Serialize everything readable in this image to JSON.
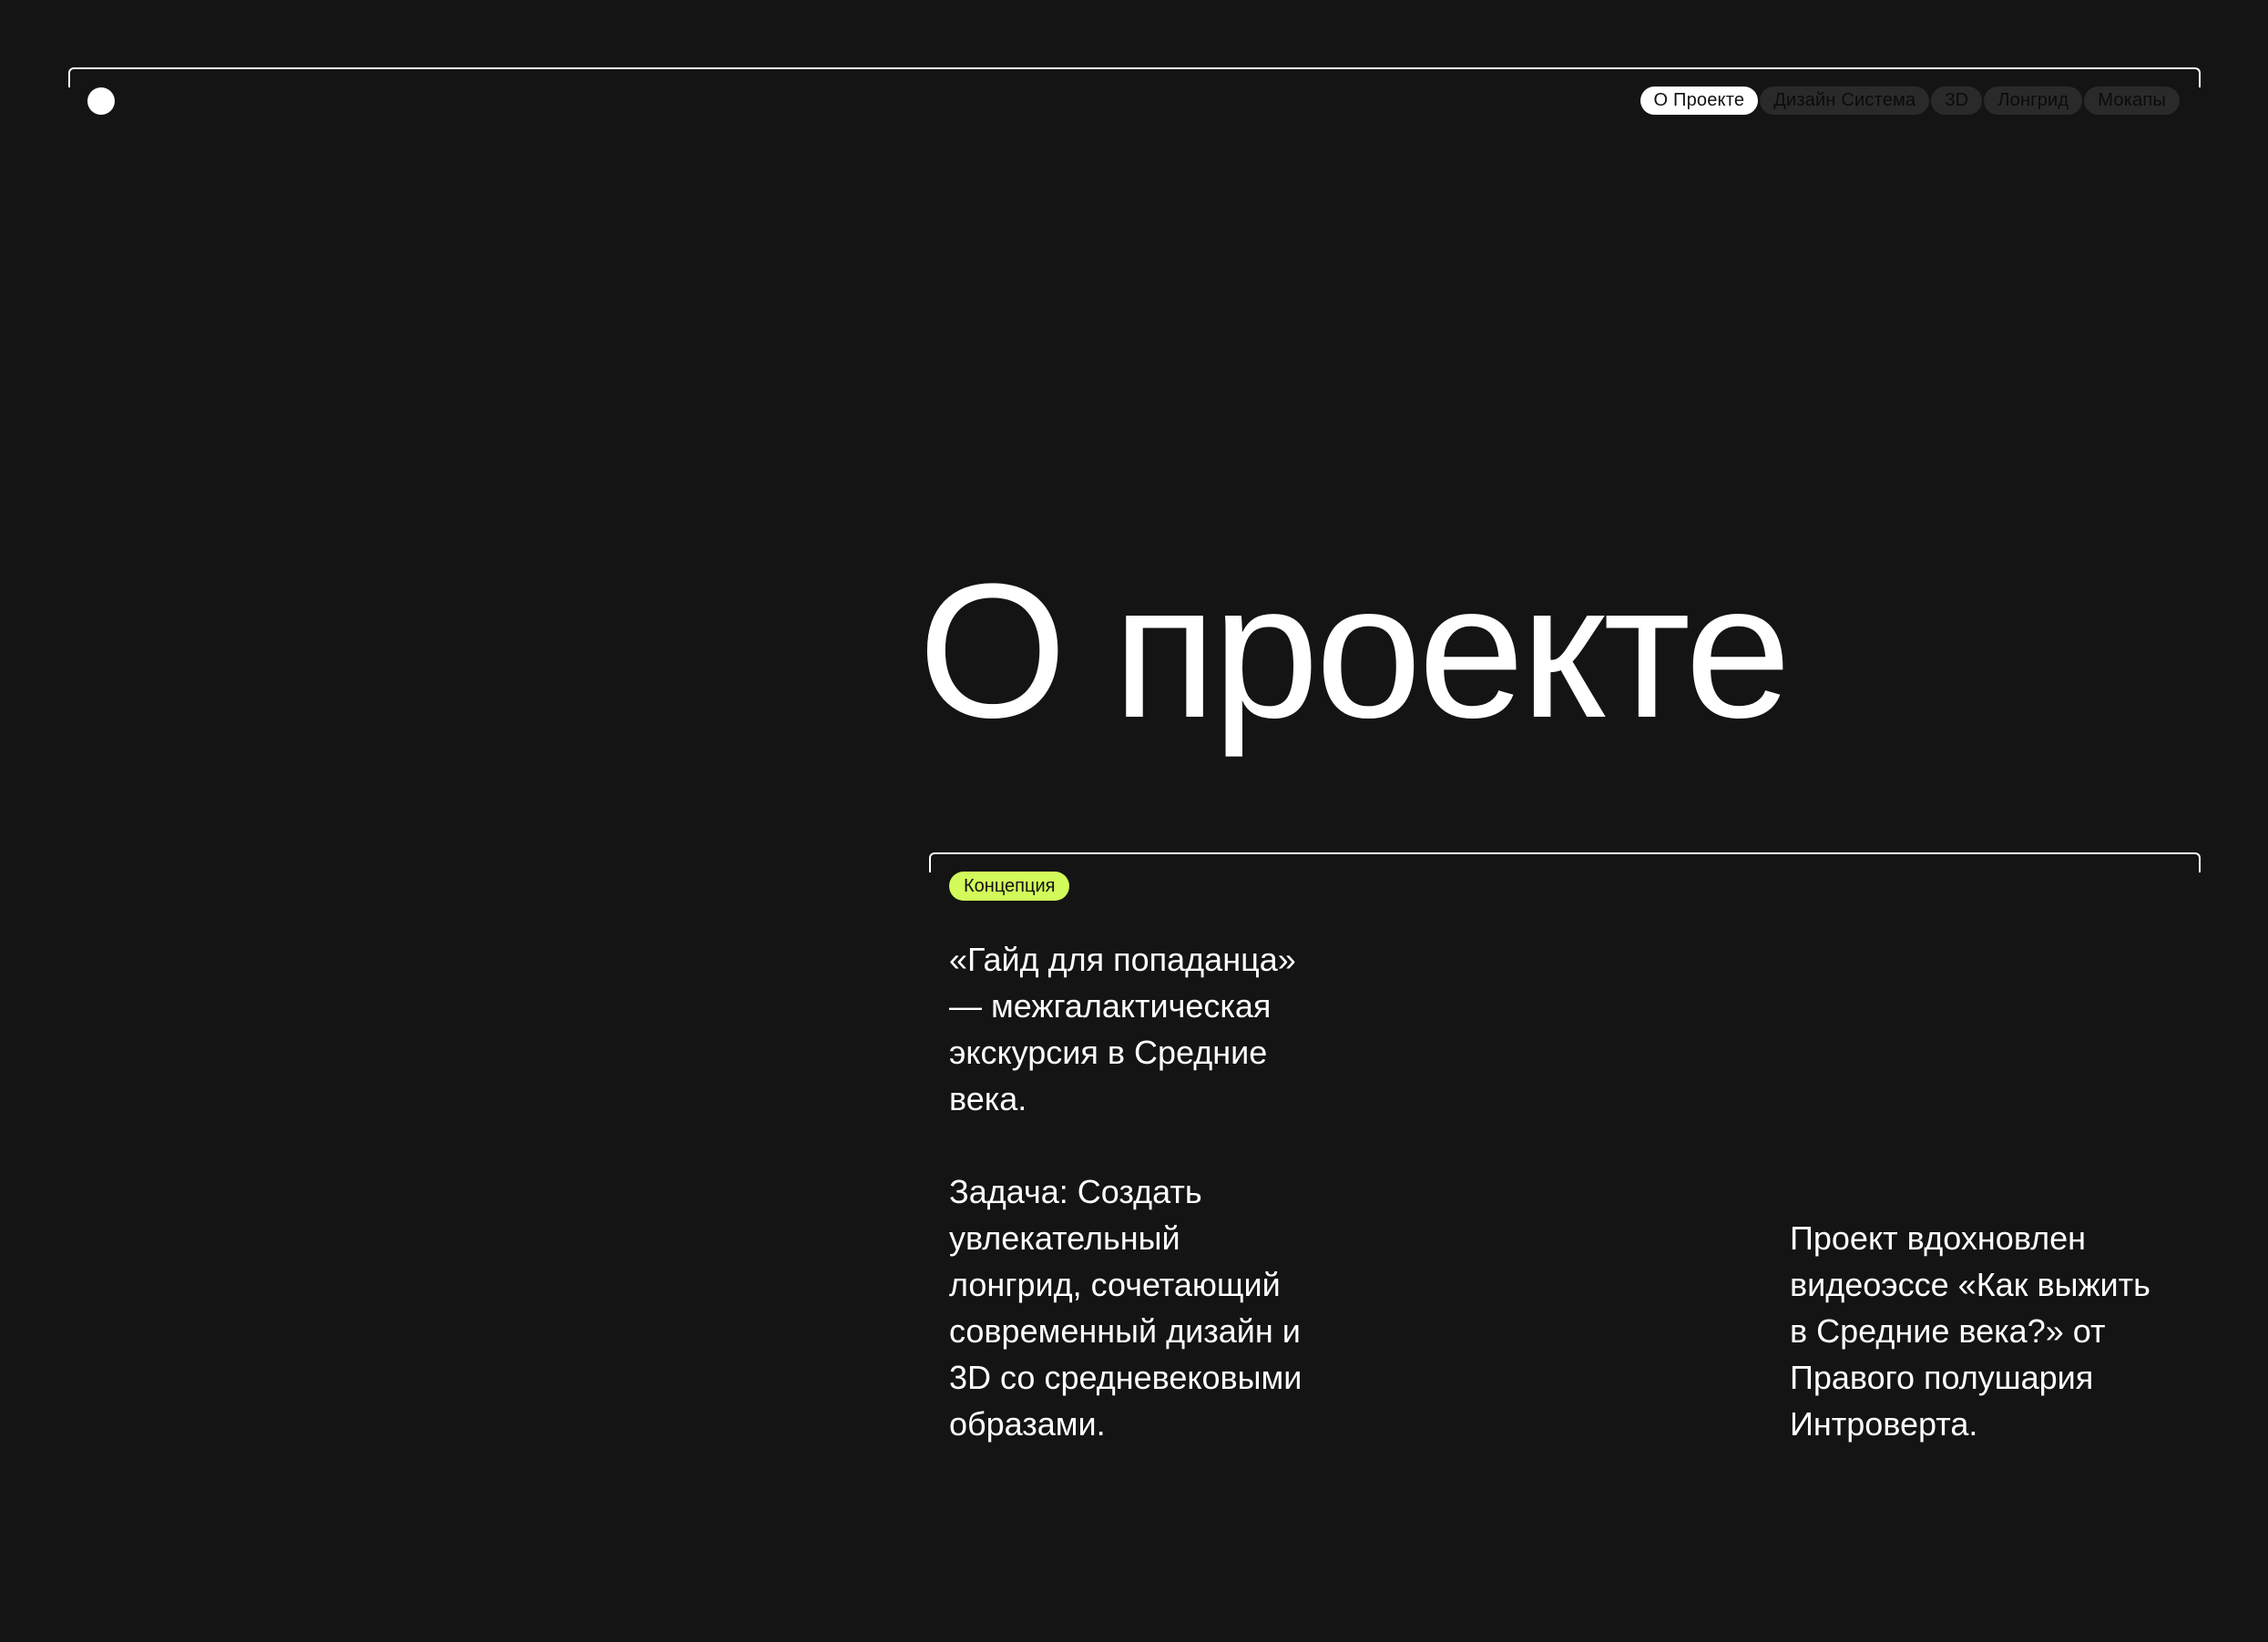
{
  "nav": {
    "items": [
      {
        "label": "О Проекте",
        "active": true
      },
      {
        "label": "Дизайн Система",
        "active": false
      },
      {
        "label": "3D",
        "active": false
      },
      {
        "label": "Лонгрид",
        "active": false
      },
      {
        "label": "Мокапы",
        "active": false
      }
    ]
  },
  "hero": {
    "title": "О проекте"
  },
  "section": {
    "tag": "Концепция",
    "left_text": "«Гайд для попаданца»\n— межгалактическая\nэкскурсия в Средние\nвека.\n\nЗадача: Создать\nувлекательный\nлонгрид, сочетающий\nсовременный дизайн и\n3D со средневековыми\nобразами.",
    "right_text": "Проект вдохновлен\nвидеоэссе «Как выжить\nв Средние века?» от\nПравого полушария\nИнтроверта."
  },
  "colors": {
    "background": "#141414",
    "accent_tag": "#d2fa5a",
    "nav_inactive": "#2a2a2a",
    "text": "#ffffff"
  }
}
